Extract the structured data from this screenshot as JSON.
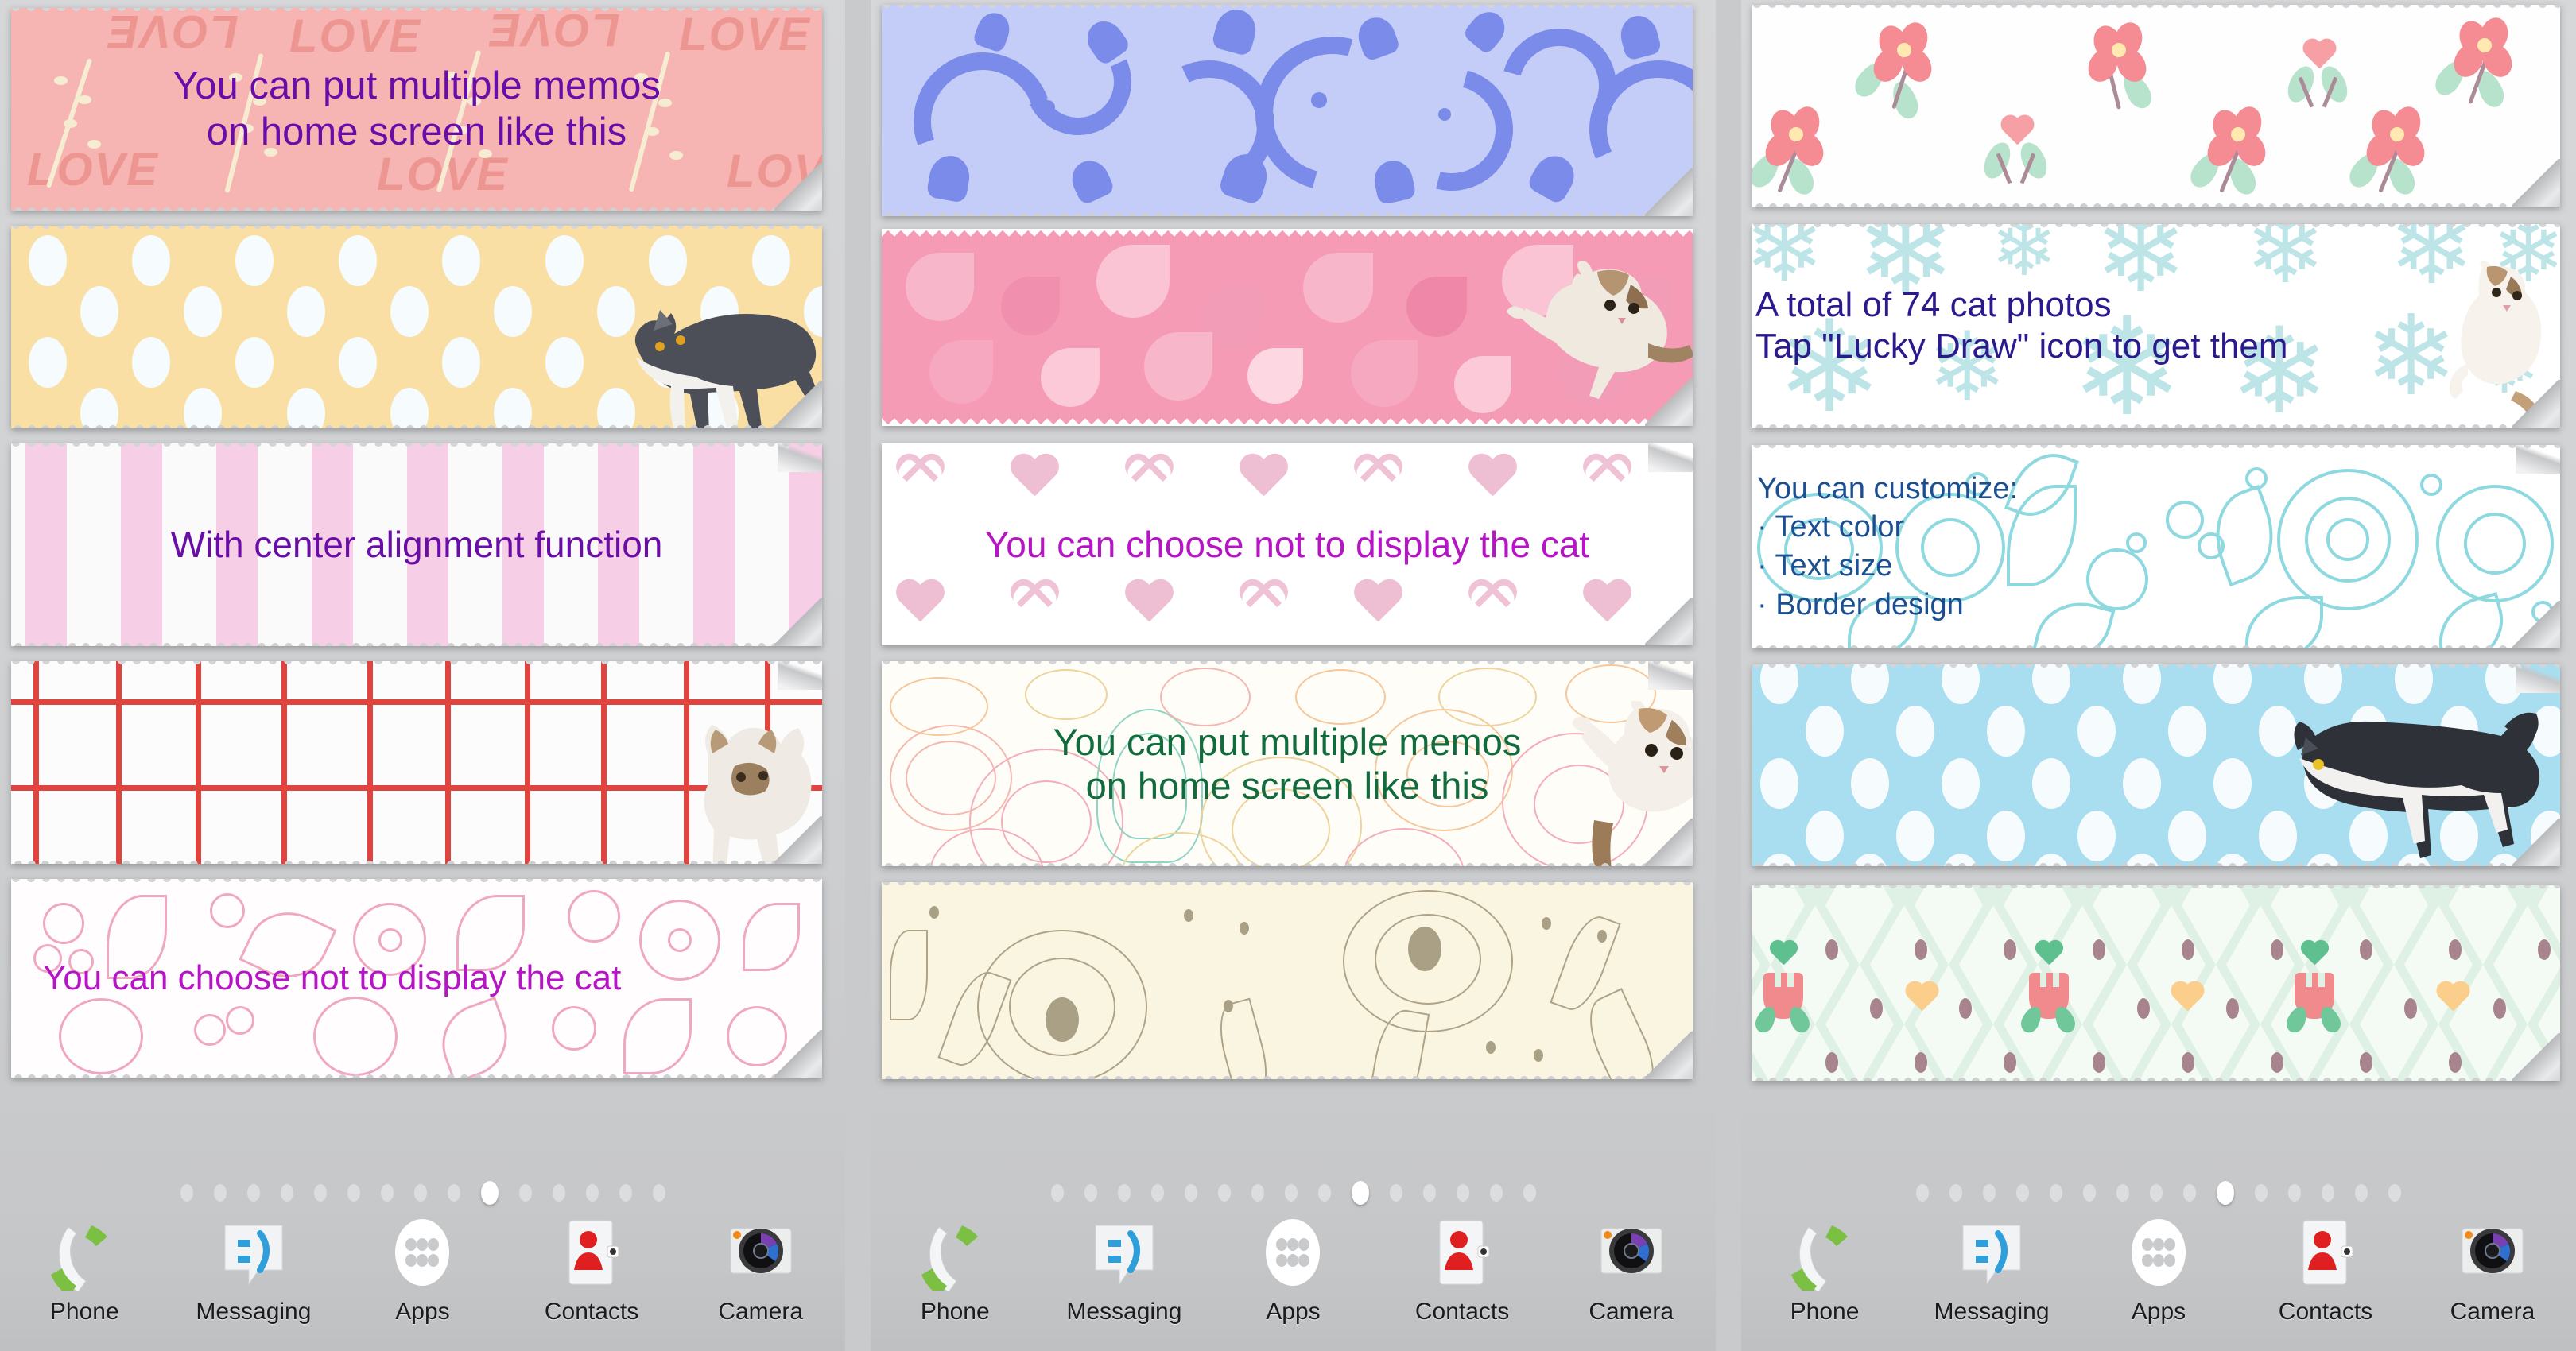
{
  "app": {
    "type": "android-home-screen-showcase",
    "panel_count": 3
  },
  "colors": {
    "purple_text": "#6a0da8",
    "magenta_text": "#b515c4",
    "green_text": "#116b3c",
    "navy_text": "#2a1a8e",
    "blue_text": "#1b4f91",
    "pink_love_bg": "#f6b5b3",
    "yellow_dot_bg": "#fadfa5",
    "blue_dot_bg": "#a9ddf0",
    "damask_bg": "#c3cdf7",
    "sakura_bg": "#f59bb6",
    "cream_bg": "#faf5e0",
    "mint_bg": "#dff0e4",
    "dock_bg": "#c4c5c7"
  },
  "panels": [
    {
      "id": "panel-1",
      "memos": [
        {
          "id": "memo-1-1",
          "pattern": "pink-love",
          "text": "You can put multiple memos\non home screen like this",
          "text_color": "#6a0da8",
          "align": "center",
          "font_size": 49,
          "has_cat": false
        },
        {
          "id": "memo-1-2",
          "pattern": "yellow-dots",
          "text": "",
          "text_color": "#6a0da8",
          "align": "center",
          "font_size": 44,
          "has_cat": true,
          "cat": "grey-white-walking"
        },
        {
          "id": "memo-1-3",
          "pattern": "pink-stripes",
          "text": "With center alignment function",
          "text_color": "#6a0da8",
          "align": "center",
          "font_size": 46,
          "has_cat": false
        },
        {
          "id": "memo-1-4",
          "pattern": "red-grid",
          "text": "",
          "text_color": "#6a0da8",
          "align": "center",
          "font_size": 44,
          "has_cat": true,
          "cat": "tabby-reaching"
        },
        {
          "id": "memo-1-5",
          "pattern": "pink-doodle-floral",
          "text": "You can choose not to display the cat",
          "text_color": "#b515c4",
          "align": "left",
          "font_size": 44,
          "has_cat": false
        }
      ],
      "pager": {
        "total": 15,
        "active_index": 9
      },
      "dock": [
        {
          "label": "Phone",
          "icon": "phone-icon"
        },
        {
          "label": "Messaging",
          "icon": "messaging-icon"
        },
        {
          "label": "Apps",
          "icon": "apps-grid-icon"
        },
        {
          "label": "Contacts",
          "icon": "contacts-icon"
        },
        {
          "label": "Camera",
          "icon": "camera-icon"
        }
      ]
    },
    {
      "id": "panel-2",
      "memos": [
        {
          "id": "memo-2-1",
          "pattern": "blue-damask",
          "text": "",
          "text_color": "#6a0da8",
          "align": "center",
          "font_size": 44,
          "has_cat": false
        },
        {
          "id": "memo-2-2",
          "pattern": "sakura-pink",
          "text": "",
          "text_color": "#6a0da8",
          "align": "center",
          "font_size": 44,
          "has_cat": true,
          "cat": "tabby-leaping"
        },
        {
          "id": "memo-2-3",
          "pattern": "pink-hearts",
          "text": "You can choose not to display the cat",
          "text_color": "#b515c4",
          "align": "center",
          "font_size": 46,
          "has_cat": false
        },
        {
          "id": "memo-2-4",
          "pattern": "line-floral",
          "text": "You can put multiple memos\non home screen like this",
          "text_color": "#116b3c",
          "align": "center",
          "font_size": 47,
          "has_cat": true,
          "cat": "tabby-paw-up"
        },
        {
          "id": "memo-2-5",
          "pattern": "cream-floral",
          "text": "",
          "text_color": "#6a0da8",
          "align": "center",
          "font_size": 44,
          "has_cat": false
        }
      ],
      "pager": {
        "total": 15,
        "active_index": 9
      },
      "dock": [
        {
          "label": "Phone",
          "icon": "phone-icon"
        },
        {
          "label": "Messaging",
          "icon": "messaging-icon"
        },
        {
          "label": "Apps",
          "icon": "apps-grid-icon"
        },
        {
          "label": "Contacts",
          "icon": "contacts-icon"
        },
        {
          "label": "Camera",
          "icon": "camera-icon"
        }
      ]
    },
    {
      "id": "panel-3",
      "memos": [
        {
          "id": "memo-3-1",
          "pattern": "pink-flowers-scatter",
          "text": "",
          "text_color": "#6a0da8",
          "align": "center",
          "font_size": 44,
          "has_cat": false
        },
        {
          "id": "memo-3-2",
          "pattern": "snowflakes",
          "text": "A total of 74 cat photos\nTap \"Lucky Draw\" icon to get them",
          "text_color": "#2a1a8e",
          "align": "left",
          "font_size": 44,
          "has_cat": true,
          "cat": "calico-standing"
        },
        {
          "id": "memo-3-3",
          "pattern": "blue-doodle-floral",
          "text": "You can customize:\n· Text color\n· Text size\n· Border design",
          "text_color": "#1b4f91",
          "align": "left",
          "font_size": 38,
          "has_cat": false
        },
        {
          "id": "memo-3-4",
          "pattern": "blue-dots",
          "text": "",
          "text_color": "#6a0da8",
          "align": "center",
          "font_size": 44,
          "has_cat": true,
          "cat": "tuxedo-walking"
        },
        {
          "id": "memo-3-5",
          "pattern": "mint-diamond-tulips",
          "text": "",
          "text_color": "#6a0da8",
          "align": "center",
          "font_size": 44,
          "has_cat": false
        }
      ],
      "pager": {
        "total": 15,
        "active_index": 9
      },
      "dock": [
        {
          "label": "Phone",
          "icon": "phone-icon"
        },
        {
          "label": "Messaging",
          "icon": "messaging-icon"
        },
        {
          "label": "Apps",
          "icon": "apps-grid-icon"
        },
        {
          "label": "Contacts",
          "icon": "contacts-icon"
        },
        {
          "label": "Camera",
          "icon": "camera-icon"
        }
      ]
    }
  ]
}
